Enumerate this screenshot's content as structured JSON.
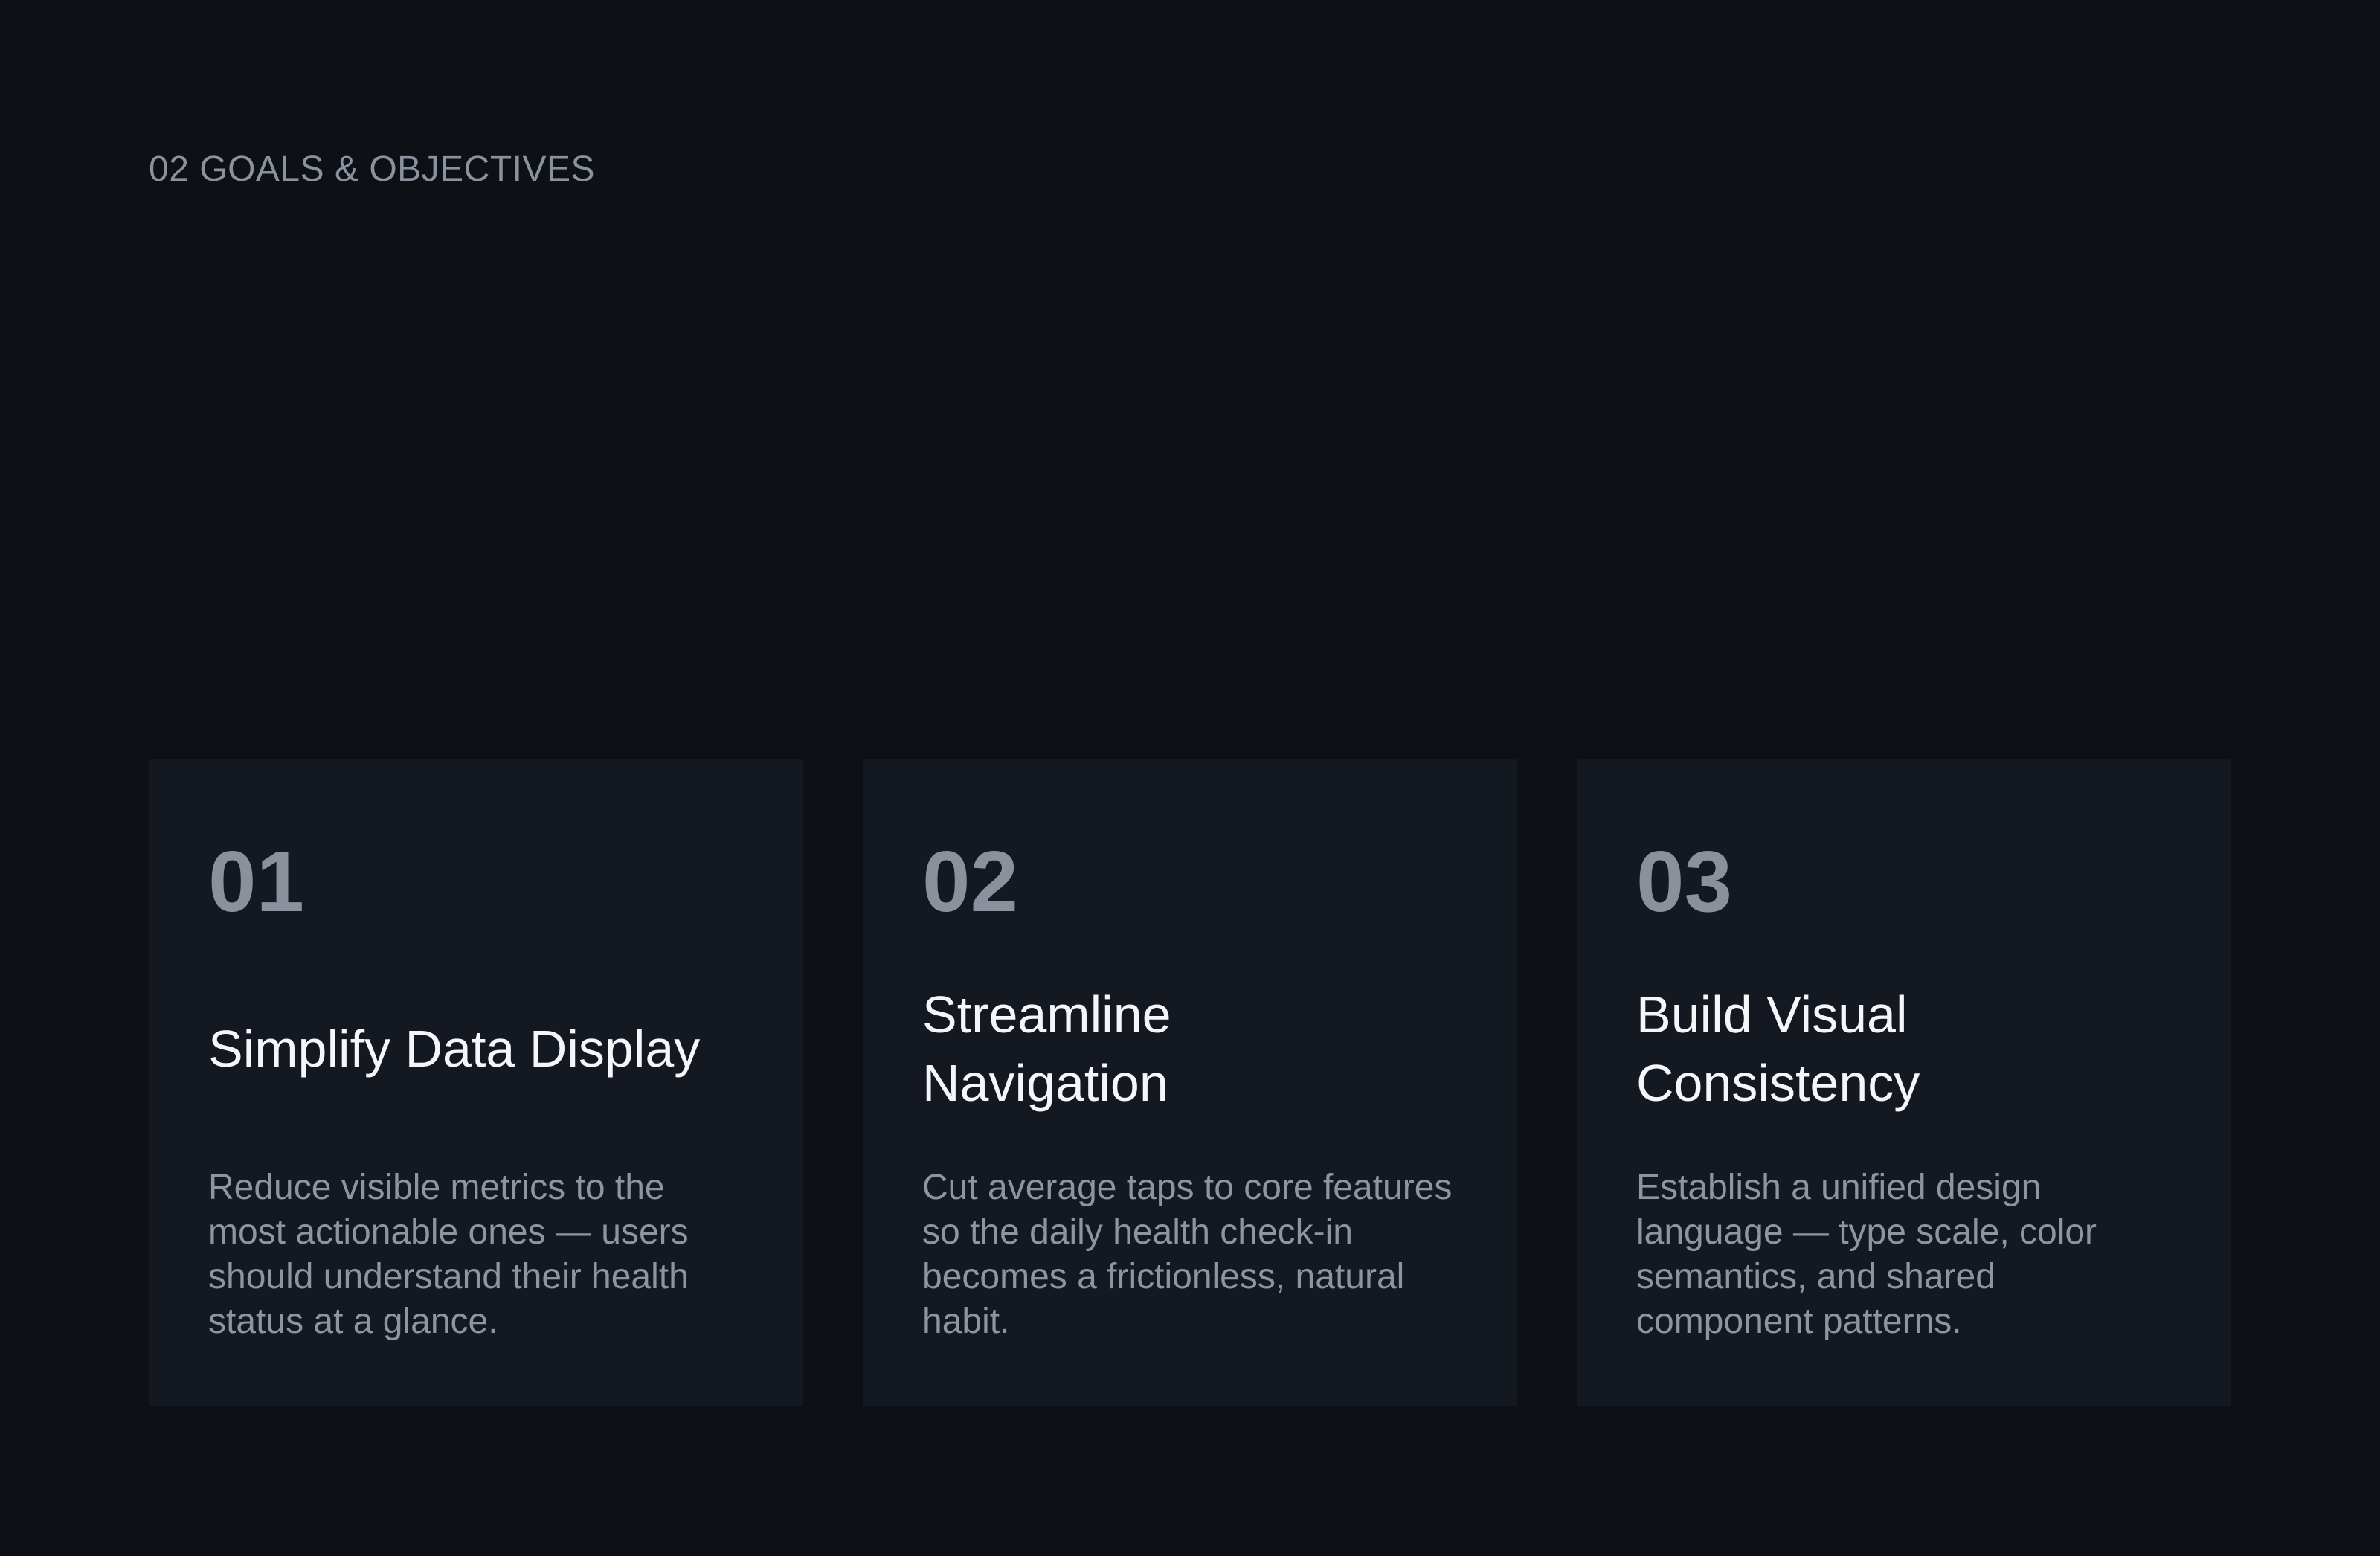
{
  "section": {
    "label": "02 GOALS & OBJECTIVES"
  },
  "cards": [
    {
      "number": "01",
      "title": "Simplify Data Display",
      "body": "Reduce visible metrics to the most actionable ones — users should understand their health status at a glance."
    },
    {
      "number": "02",
      "title": "Streamline Navigation",
      "body": "Cut average taps to core features so the daily health check-in becomes a frictionless, natural habit."
    },
    {
      "number": "03",
      "title": "Build Visual Consistency",
      "body": "Establish a unified design language — type scale, color semantics, and shared component patterns."
    }
  ],
  "colors": {
    "background": "#0d1015",
    "card_background": "#141821",
    "number_text": "#8b919c",
    "title_text": "#f4f6f9",
    "body_text": "#8e95a1",
    "label_text": "#8a929e"
  }
}
